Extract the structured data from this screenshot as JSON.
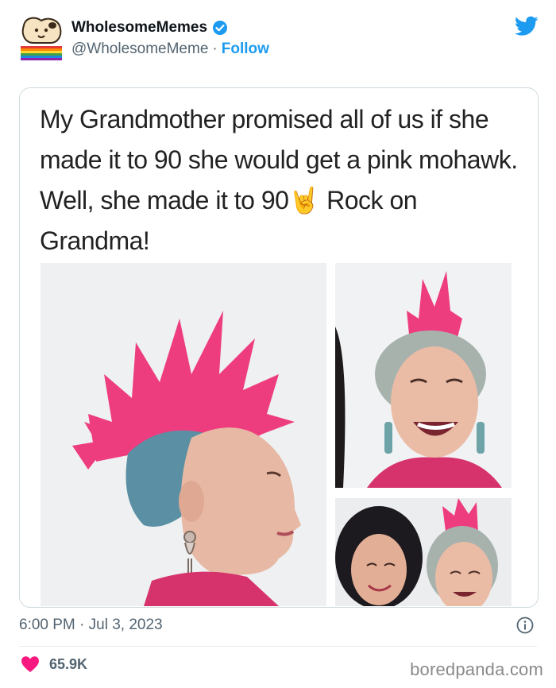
{
  "user": {
    "display_name": "WholesomeMemes",
    "handle": "@WholesomeMeme",
    "separator": "·",
    "follow_label": "Follow"
  },
  "post": {
    "caption": "My Grandmother promised all of us if she made it to 90 she would get a pink mohawk. Well, she made it to 90🤘 Rock on Grandma!",
    "timestamp": "6:00 PM · Jul 3, 2023",
    "likes": "65.9K"
  },
  "watermark": "boredpanda.com",
  "icons": {
    "avatar": "dog-avatar-icon",
    "verified": "verified-badge-icon",
    "brand": "twitter-bird-icon",
    "info": "info-icon",
    "like": "heart-icon"
  },
  "colors": {
    "accent": "#1d9bf0",
    "like": "#f91880",
    "muted": "#536471",
    "hair_pink": "#ee3d7f"
  }
}
